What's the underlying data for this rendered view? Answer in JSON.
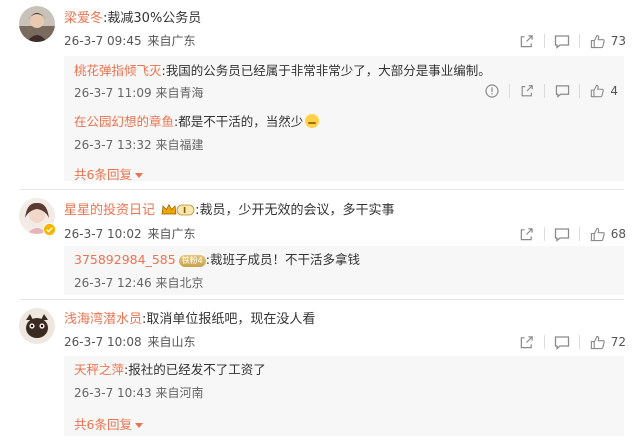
{
  "comments": [
    {
      "user": "梁爱冬",
      "text": ":裁减30%公务员",
      "time": "26-3-7 09:45",
      "source": "来自广东",
      "likes": "73",
      "replies": [
        {
          "user": "桃花弹指倾飞灭",
          "text": ":我国的公务员已经属于非常非常少了，大部分是事业编制。",
          "time": "26-3-7 11:09",
          "source": "来自青海",
          "likes": "4"
        },
        {
          "user": "在公园幻想的章鱼",
          "text": ":都是不干活的，当然少",
          "time": "26-3-7 13:32",
          "source": "来自福建"
        }
      ],
      "more_label": "共6条回复"
    },
    {
      "user": "星星的投资日记",
      "text": ":裁员，少开无效的会议，多干实事",
      "time": "26-3-7 10:02",
      "source": "来自广东",
      "likes": "68",
      "replies": [
        {
          "user": "375892984_585",
          "badge": "铁粉4",
          "text": ":裁班子成员！不干活多拿钱",
          "time": "26-3-7 12:46",
          "source": "来自北京"
        }
      ]
    },
    {
      "user": "浅海湾潜水员",
      "text": ":取消单位报纸吧，现在没人看",
      "time": "26-3-7 10:08",
      "source": "来自山东",
      "likes": "72",
      "replies": [
        {
          "user": "天秤之萍",
          "text": ":报社的已经发不了工资了",
          "time": "26-3-7 10:43",
          "source": "来自河南"
        }
      ],
      "more_label": "共6条回复"
    }
  ],
  "icons": [
    "share-icon",
    "comment-icon",
    "like-icon",
    "report-icon"
  ],
  "colors": {
    "username": "#eb7350",
    "text": "#333333",
    "meta": "#555555",
    "icon": "#8a8a8a",
    "reply_bg": "#f7f7f7"
  }
}
